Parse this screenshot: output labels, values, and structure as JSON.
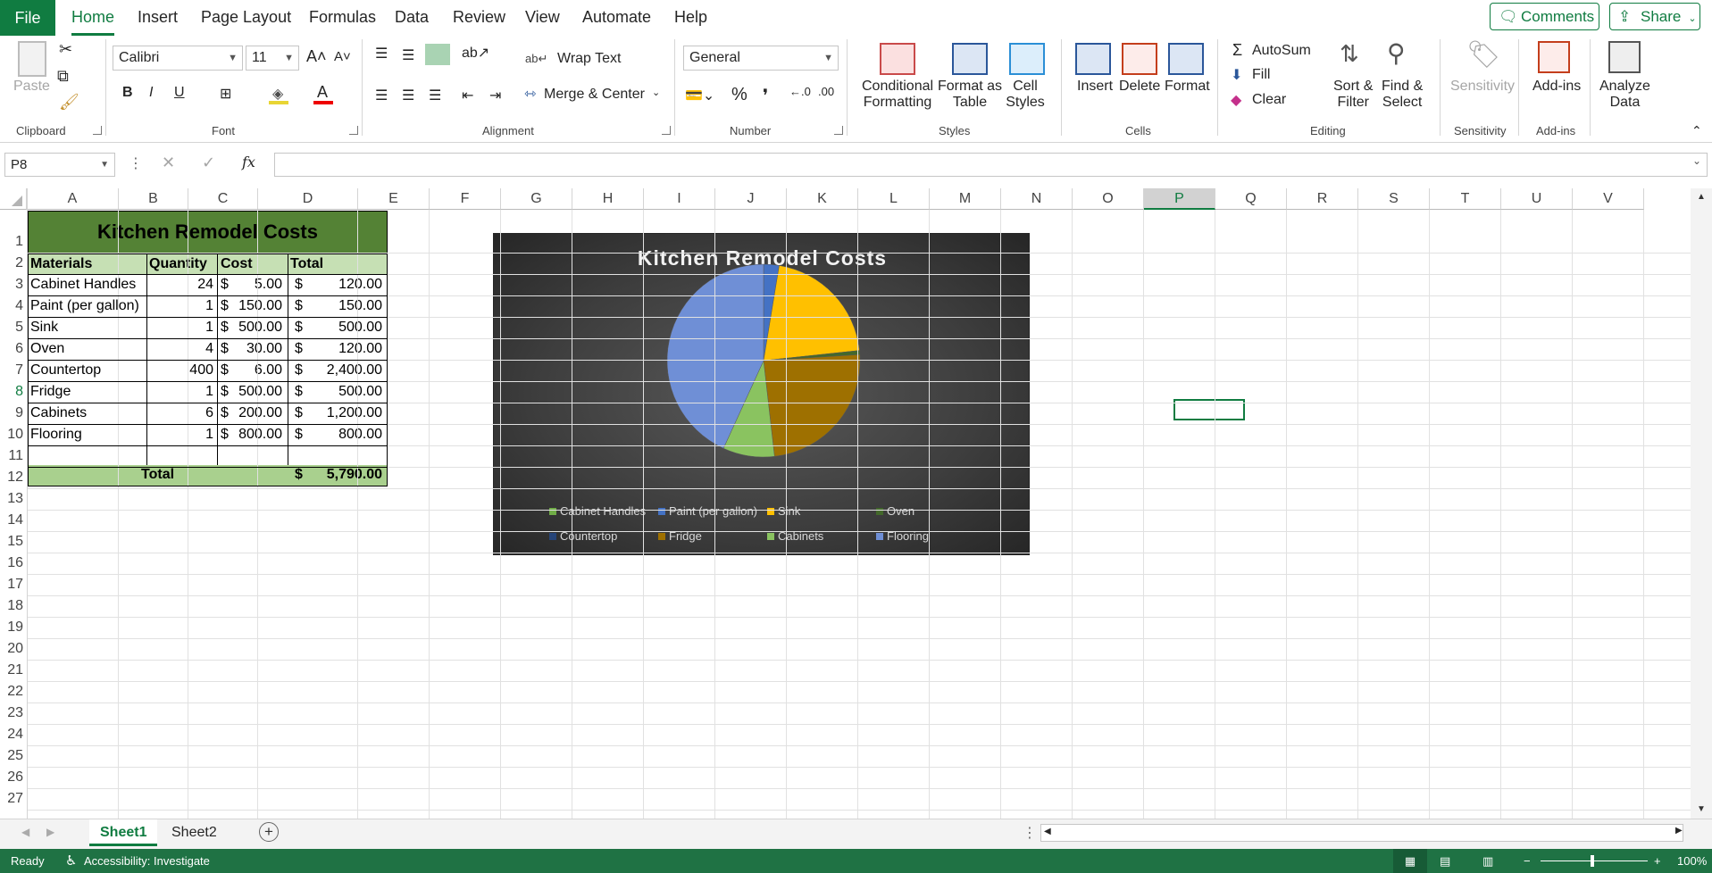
{
  "menu": {
    "file": "File",
    "tabs": [
      "Home",
      "Insert",
      "Page Layout",
      "Formulas",
      "Data",
      "Review",
      "View",
      "Automate",
      "Help"
    ],
    "comments": "Comments",
    "share": "Share"
  },
  "ribbon": {
    "clipboard": {
      "paste": "Paste",
      "group": "Clipboard"
    },
    "font": {
      "name": "Calibri",
      "size": "11",
      "group": "Font",
      "bold": "B",
      "italic": "I",
      "underline": "U"
    },
    "alignment": {
      "wrap": "Wrap Text",
      "merge": "Merge & Center",
      "group": "Alignment"
    },
    "number": {
      "format": "General",
      "group": "Number",
      "percent": "%",
      "comma": "❜"
    },
    "styles": {
      "conditional": [
        "Conditional",
        "Formatting"
      ],
      "format_table": [
        "Format as",
        "Table"
      ],
      "cell_styles": [
        "Cell",
        "Styles"
      ],
      "group": "Styles"
    },
    "cells": {
      "insert": "Insert",
      "delete": "Delete",
      "format": "Format",
      "group": "Cells"
    },
    "editing": {
      "autosum": "AutoSum",
      "fill": "Fill",
      "clear": "Clear",
      "sort": [
        "Sort &",
        "Filter"
      ],
      "find": [
        "Find &",
        "Select"
      ],
      "group": "Editing"
    },
    "sensitivity": {
      "label": "Sensitivity",
      "group": "Sensitivity"
    },
    "addins": {
      "label": "Add-ins",
      "group": "Add-ins"
    },
    "analyze": {
      "label": [
        "Analyze",
        "Data"
      ]
    }
  },
  "formula_bar": {
    "name_box": "P8",
    "fx": "fx",
    "value": ""
  },
  "columns": [
    "A",
    "B",
    "C",
    "D",
    "E",
    "F",
    "G",
    "H",
    "I",
    "J",
    "K",
    "L",
    "M",
    "N",
    "O",
    "P",
    "Q",
    "R",
    "S",
    "T",
    "U",
    "V"
  ],
  "rows": [
    "1",
    "2",
    "3",
    "4",
    "5",
    "6",
    "7",
    "8",
    "9",
    "10",
    "11",
    "12",
    "13",
    "14",
    "15",
    "16",
    "17",
    "18",
    "19",
    "20",
    "21",
    "22",
    "23",
    "24",
    "25",
    "26",
    "27"
  ],
  "table": {
    "title": "Kitchen Remodel Costs",
    "headers": [
      "Materials",
      "Quantity",
      "Cost",
      "Total"
    ],
    "rows": [
      {
        "material": "Cabinet Handles",
        "qty": "24",
        "cost_sym": "$",
        "cost": "5.00",
        "total_sym": "$",
        "total": "120.00"
      },
      {
        "material": "Paint (per gallon)",
        "qty": "1",
        "cost_sym": "$",
        "cost": "150.00",
        "total_sym": "$",
        "total": "150.00"
      },
      {
        "material": "Sink",
        "qty": "1",
        "cost_sym": "$",
        "cost": "500.00",
        "total_sym": "$",
        "total": "500.00"
      },
      {
        "material": "Oven",
        "qty": "4",
        "cost_sym": "$",
        "cost": "30.00",
        "total_sym": "$",
        "total": "120.00"
      },
      {
        "material": "Countertop",
        "qty": "400",
        "cost_sym": "$",
        "cost": "6.00",
        "total_sym": "$",
        "total": "2,400.00"
      },
      {
        "material": "Fridge",
        "qty": "1",
        "cost_sym": "$",
        "cost": "500.00",
        "total_sym": "$",
        "total": "500.00"
      },
      {
        "material": "Cabinets",
        "qty": "6",
        "cost_sym": "$",
        "cost": "200.00",
        "total_sym": "$",
        "total": "1,200.00"
      },
      {
        "material": "Flooring",
        "qty": "1",
        "cost_sym": "$",
        "cost": "800.00",
        "total_sym": "$",
        "total": "800.00"
      }
    ],
    "total_label": "Total",
    "grand_sym": "$",
    "grand_total": "5,790.00"
  },
  "chart_data": {
    "type": "pie",
    "title": "Kitchen Remodel Costs",
    "categories": [
      "Cabinet Handles",
      "Paint (per gallon)",
      "Sink",
      "Oven",
      "Countertop",
      "Fridge",
      "Cabinets",
      "Flooring"
    ],
    "values": [
      0,
      150,
      1200,
      40,
      0,
      1400,
      500,
      2500
    ],
    "colors": [
      "#70ad47",
      "#4472c4",
      "#ffc000",
      "#43682b",
      "#264478",
      "#9e7000",
      "#8ac360",
      "#6f8fd6"
    ],
    "legend_position": "bottom"
  },
  "sheets": {
    "tabs": [
      "Sheet1",
      "Sheet2"
    ],
    "active": "Sheet1"
  },
  "status": {
    "ready": "Ready",
    "accessibility": "Accessibility: Investigate",
    "zoom": "100%"
  }
}
